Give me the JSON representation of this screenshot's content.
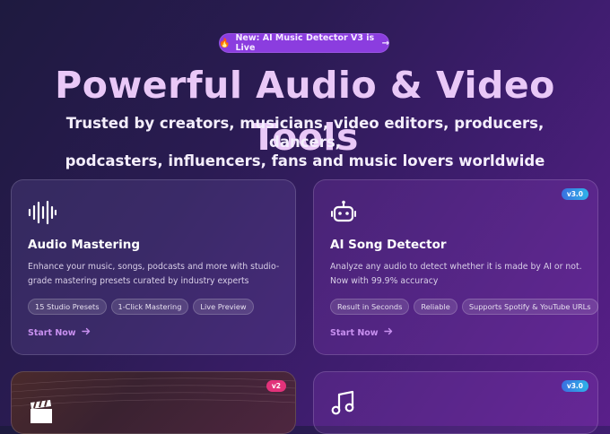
{
  "announcement": {
    "emoji": "🔥",
    "text": "New: AI Music Detector V3 is Live",
    "arrow": "→"
  },
  "hero": {
    "title": "Powerful Audio & Video Tools",
    "subtitle_line1": "Trusted by creators, musicians, video editors, producers, dancers,",
    "subtitle_line2": "podcasters, influencers, fans and music lovers worldwide"
  },
  "cards": [
    {
      "icon": "sound-wave-icon",
      "title": "Audio Mastering",
      "description": "Enhance your music, songs, podcasts and more with studio-grade mastering presets curated by industry experts",
      "tags": [
        "15 Studio Presets",
        "1-Click Mastering",
        "Live Preview"
      ],
      "cta": "Start Now",
      "badge": ""
    },
    {
      "icon": "robot-icon",
      "title": "AI Song Detector",
      "description": "Analyze any audio to detect whether it is made by AI or not. Now with 99.9% accuracy",
      "tags": [
        "Result in Seconds",
        "Reliable",
        "Supports Spotify & YouTube URLs"
      ],
      "cta": "Start Now",
      "badge": "v3.0"
    },
    {
      "icon": "clapperboard-icon",
      "badge": "v2"
    },
    {
      "icon": "music-note-icon",
      "badge": "v3.0"
    }
  ],
  "colors": {
    "accent": "#8b3ddf",
    "title": "#e9c8f7",
    "cta": "#c890f0",
    "badge_pink": "#e2327a"
  }
}
